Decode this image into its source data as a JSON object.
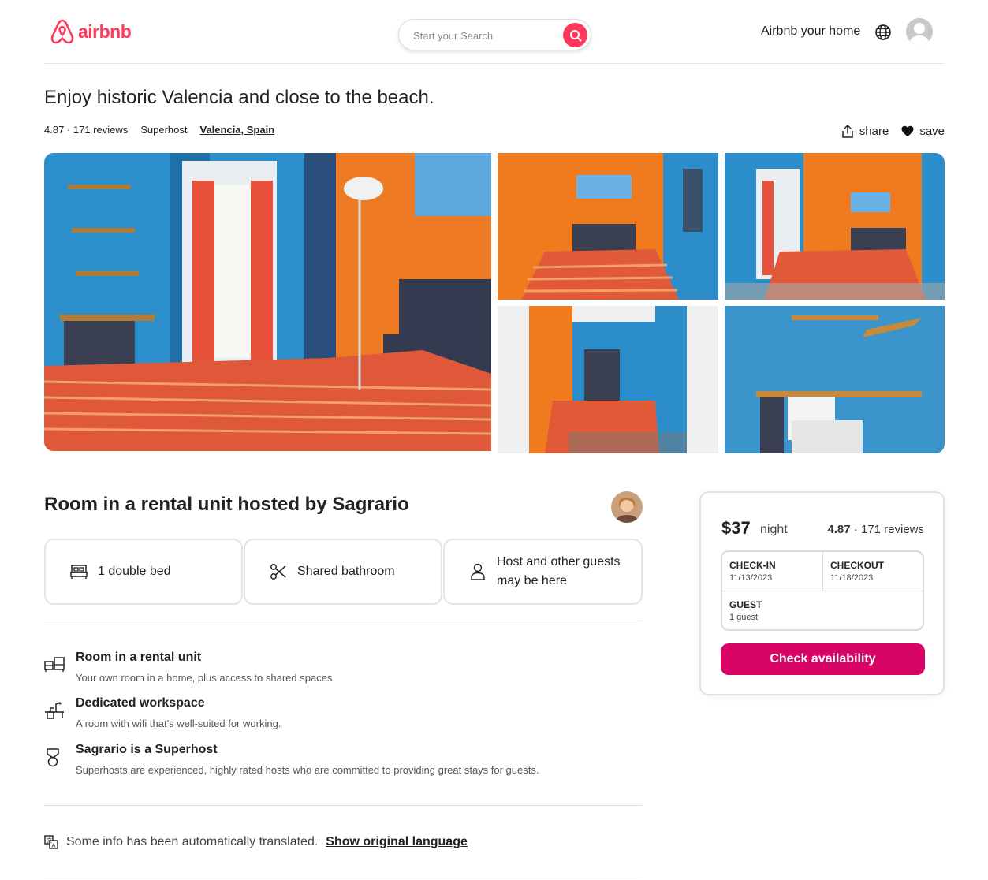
{
  "header": {
    "logo_text": "airbnb",
    "search_placeholder": "Start your Search",
    "host_link": "Airbnb your home"
  },
  "listing": {
    "title": "Enjoy historic Valencia and close to the beach.",
    "rating_reviews": "4.87 · 171 reviews",
    "host_status": "Superhost",
    "location": "Valencia, Spain",
    "share_label": "share",
    "save_label": "save"
  },
  "room": {
    "title": "Room in a rental unit hosted by Sagrario",
    "features": [
      {
        "icon": "bed-icon",
        "label": "1 double bed"
      },
      {
        "icon": "scissors-icon",
        "label": "Shared bathroom"
      },
      {
        "icon": "person-icon",
        "label": "Host and other guests may be here"
      }
    ],
    "highlights": [
      {
        "icon": "rental-unit-icon",
        "title": "Room in a rental unit",
        "desc": "Your own room in a home, plus access to shared spaces."
      },
      {
        "icon": "workspace-icon",
        "title": "Dedicated workspace",
        "desc": "A room with wifi that's well-suited for working."
      },
      {
        "icon": "superhost-medal-icon",
        "title": "Sagrario is a Superhost",
        "desc": "Superhosts are experienced, highly rated hosts who are committed to providing great stays for guests."
      }
    ],
    "translate_notice": "Some info has been automatically translated.",
    "translate_link": "Show original language"
  },
  "booking": {
    "price": "$37",
    "per": "night",
    "rating": "4.87",
    "reviews": "· 171 reviews",
    "checkin_label": "CHECK-IN",
    "checkin_value": "11/13/2023",
    "checkout_label": "CHECKOUT",
    "checkout_value": "11/18/2023",
    "guest_label": "GUEST",
    "guest_value": "1 guest",
    "cta": "Check availability"
  },
  "colors": {
    "brand": "#ff385c",
    "cta": "#d70466",
    "wall_orange": "#f07a1e",
    "wall_blue": "#2f8fcc"
  }
}
